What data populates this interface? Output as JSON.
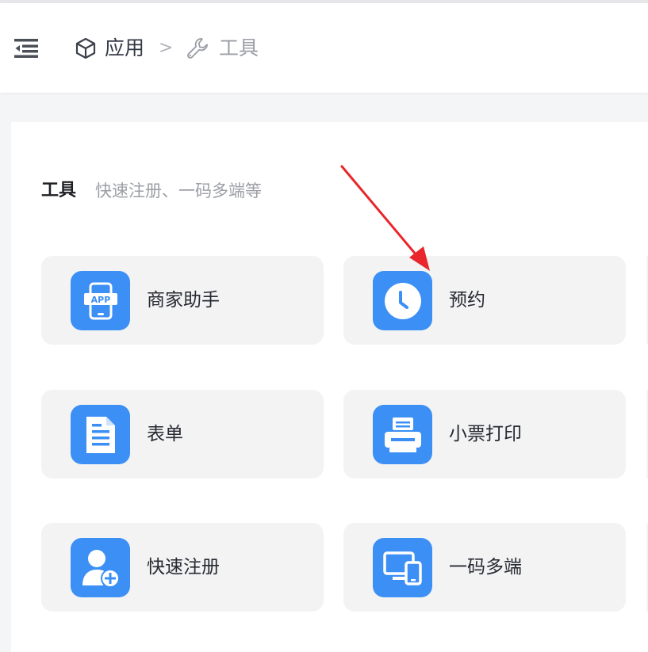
{
  "breadcrumb": {
    "apps_label": "应用",
    "separator": ">",
    "tools_label": "工具"
  },
  "section": {
    "title": "工具",
    "subtitle": "快速注册、一码多端等"
  },
  "tools": [
    {
      "label": "商家助手",
      "icon": "app-phone-icon"
    },
    {
      "label": "预约",
      "icon": "clock-icon"
    },
    {
      "label": "表单",
      "icon": "document-icon"
    },
    {
      "label": "小票打印",
      "icon": "printer-icon"
    },
    {
      "label": "快速注册",
      "icon": "user-add-icon"
    },
    {
      "label": "一码多端",
      "icon": "multi-device-icon"
    }
  ],
  "colors": {
    "icon_bg": "#3b8ff5",
    "card_bg": "#f3f3f4",
    "annotation_arrow": "#e8262b"
  }
}
